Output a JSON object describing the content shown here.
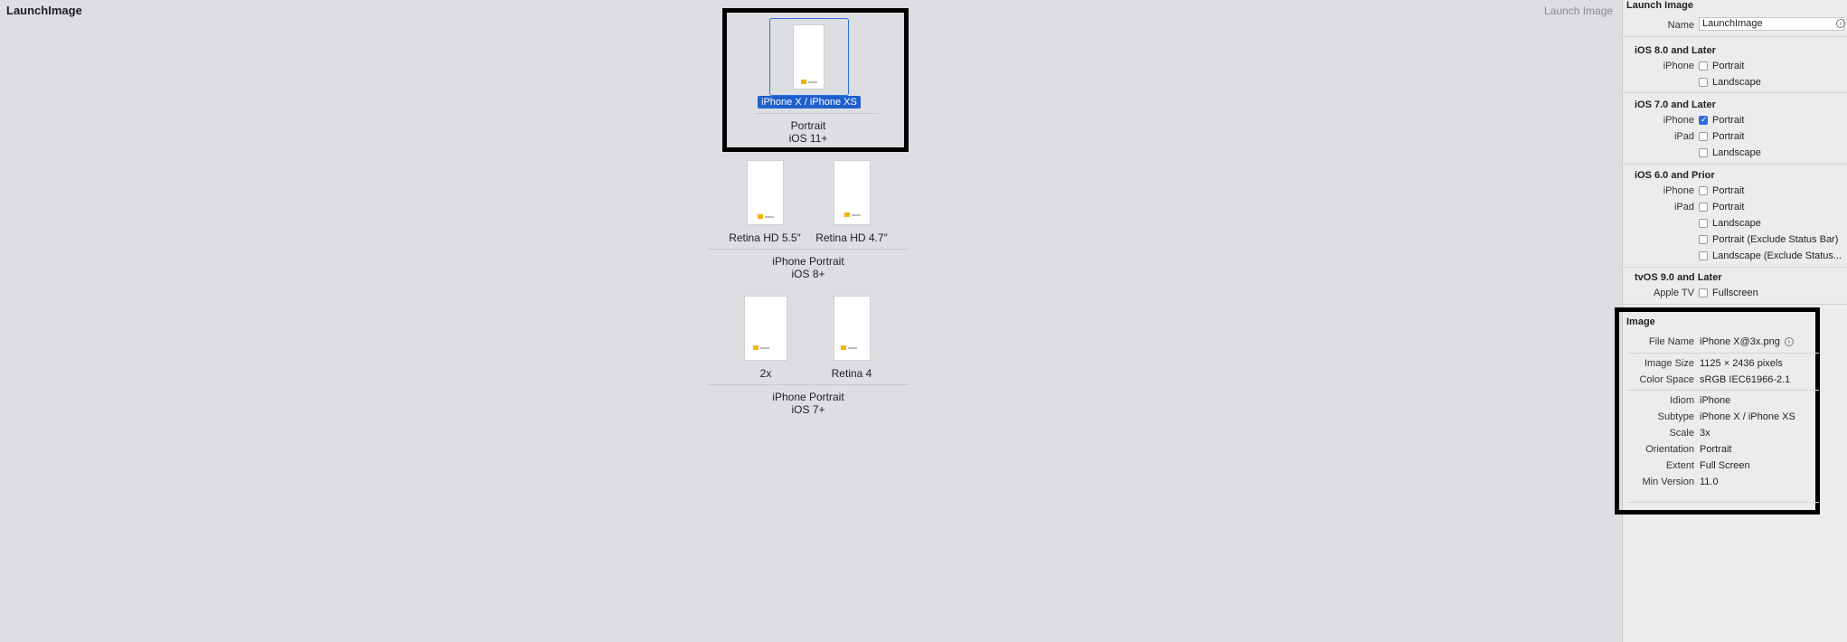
{
  "canvas": {
    "title": "LaunchImage",
    "top_right_label": "Launch Image"
  },
  "groups": [
    {
      "slots": [
        {
          "label": "iPhone X / iPhone XS",
          "selected": true
        }
      ],
      "caption_line1": "Portrait",
      "caption_line2": "iOS 11+"
    },
    {
      "slots": [
        {
          "label": "Retina HD 5.5″"
        },
        {
          "label": "Retina HD 4.7″"
        }
      ],
      "caption_line1": "iPhone Portrait",
      "caption_line2": "iOS 8+"
    },
    {
      "slots": [
        {
          "label": "2x"
        },
        {
          "label": "Retina 4"
        }
      ],
      "caption_line1": "iPhone Portrait",
      "caption_line2": "iOS 7+"
    }
  ],
  "inspector": {
    "launch_image_header": "Launch Image",
    "name_label": "Name",
    "name_value": "LaunchImage",
    "ios8": {
      "header": "iOS 8.0 and Later",
      "iphone_label": "iPhone",
      "portrait": "Portrait",
      "portrait_checked": false,
      "landscape": "Landscape",
      "landscape_checked": false
    },
    "ios7": {
      "header": "iOS 7.0 and Later",
      "iphone_label": "iPhone",
      "iphone_portrait": "Portrait",
      "iphone_portrait_checked": true,
      "ipad_label": "iPad",
      "ipad_portrait": "Portrait",
      "ipad_portrait_checked": false,
      "ipad_landscape": "Landscape",
      "ipad_landscape_checked": false
    },
    "ios6": {
      "header": "iOS 6.0 and Prior",
      "iphone_label": "iPhone",
      "iphone_portrait": "Portrait",
      "ipad_label": "iPad",
      "ipad_portrait": "Portrait",
      "ipad_landscape": "Landscape",
      "ipad_portrait_exclude": "Portrait (Exclude Status Bar)",
      "ipad_landscape_exclude": "Landscape (Exclude Status..."
    },
    "tvos": {
      "header": "tvOS 9.0 and Later",
      "appletv_label": "Apple TV",
      "fullscreen": "Fullscreen"
    },
    "image": {
      "header": "Image",
      "file_name_label": "File Name",
      "file_name": "iPhone X@3x.png",
      "image_size_label": "Image Size",
      "image_size": "1125 × 2436 pixels",
      "color_space_label": "Color Space",
      "color_space": "sRGB IEC61966-2.1",
      "idiom_label": "Idiom",
      "idiom": "iPhone",
      "subtype_label": "Subtype",
      "subtype": "iPhone X / iPhone XS",
      "scale_label": "Scale",
      "scale": "3x",
      "orientation_label": "Orientation",
      "orientation": "Portrait",
      "extent_label": "Extent",
      "extent": "Full Screen",
      "min_version_label": "Min Version",
      "min_version": "11.0"
    }
  },
  "colors": {
    "canvas_bg": "#dddee1",
    "selection_blue": "#1f5fcc",
    "logo_yellow": "#f3b400",
    "checkbox_on": "#2d6fe0"
  }
}
